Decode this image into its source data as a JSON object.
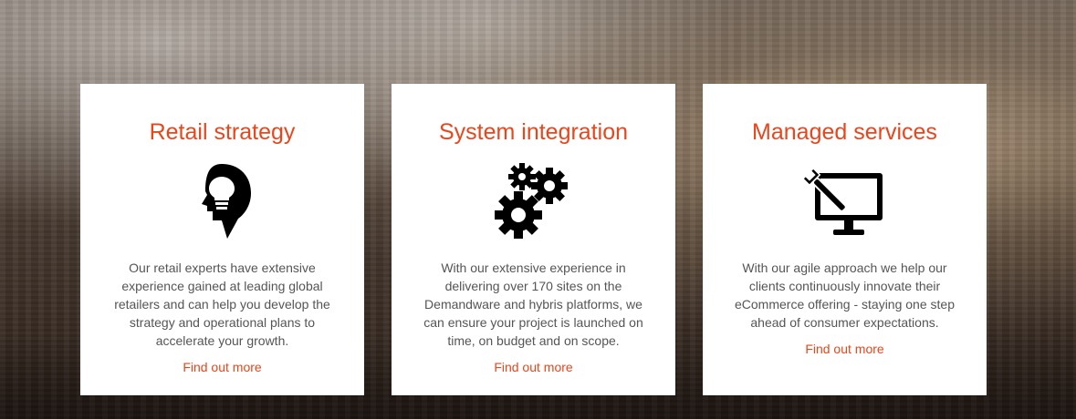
{
  "cards": [
    {
      "title": "Retail strategy",
      "icon": "head-lightbulb-icon",
      "text": "Our retail experts have extensive experience gained at leading global retailers and can help you develop the strategy and operational plans to accelerate your growth.",
      "link": "Find out more"
    },
    {
      "title": "System integration",
      "icon": "gears-icon",
      "text": "With our extensive experience in delivering over 170 sites on the Demandware and hybris platforms, we can ensure your project is launched on time, on budget and on scope.",
      "link": "Find out more"
    },
    {
      "title": "Managed services",
      "icon": "monitor-wrench-icon",
      "text": "With our agile approach we help our clients continuously innovate their eCommerce offering - staying one step ahead of consumer expectations.",
      "link": "Find out more"
    }
  ],
  "colors": {
    "accent": "#e8461c",
    "body_text": "#555555",
    "card_background": "#ffffff"
  }
}
